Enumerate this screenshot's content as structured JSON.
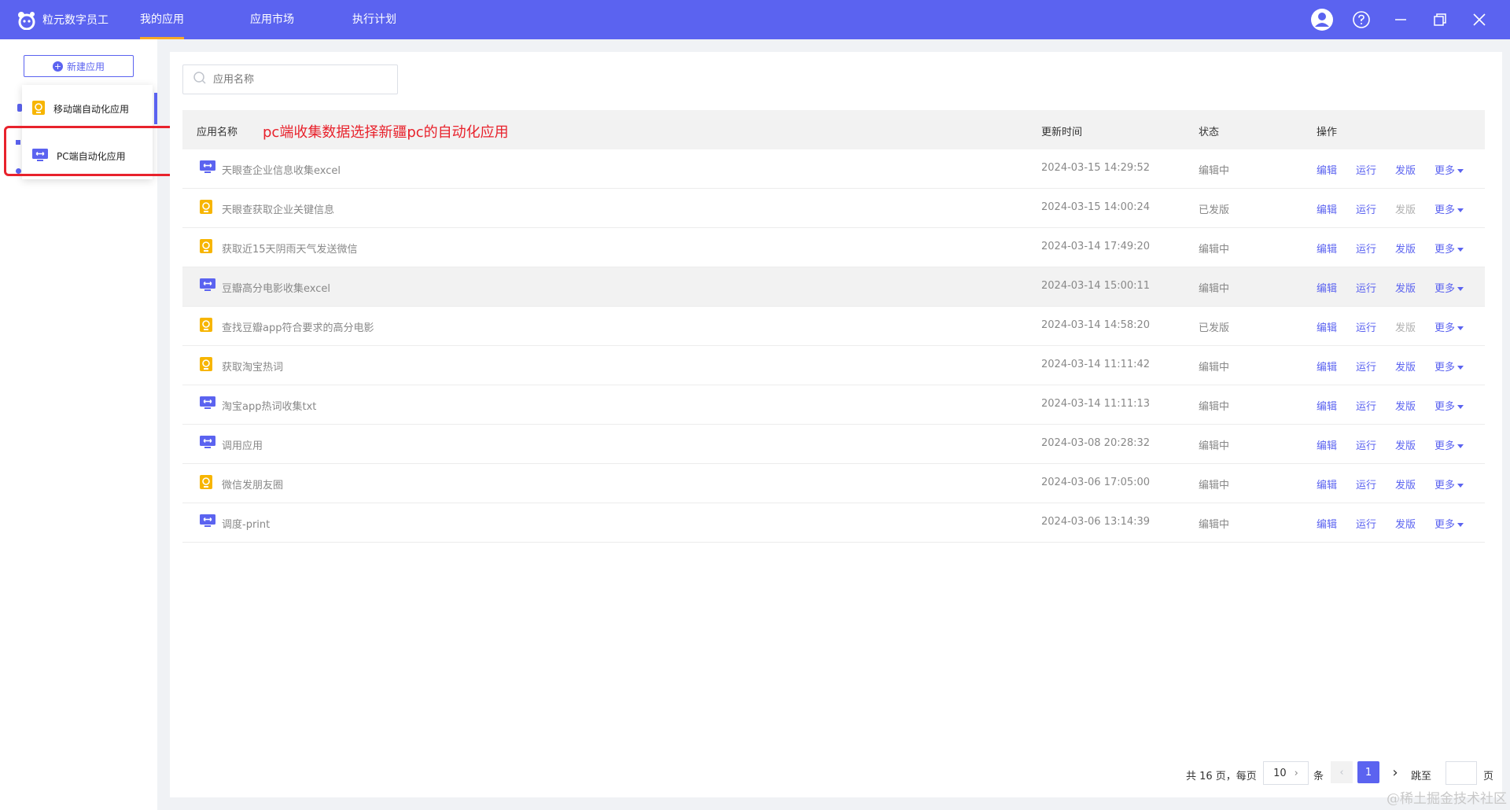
{
  "app": {
    "name": "粒元数字员工"
  },
  "nav": [
    {
      "label": "我的应用",
      "active": true
    },
    {
      "label": "应用市场",
      "active": false
    },
    {
      "label": "执行计划",
      "active": false
    }
  ],
  "window_controls": [
    "user-icon",
    "help-icon",
    "minimize-icon",
    "restore-icon",
    "close-icon"
  ],
  "sidebar": {
    "new_button": "新建应用"
  },
  "dropdown": {
    "items": [
      {
        "label": "移动端自动化应用",
        "icon": "mobile-app-icon"
      },
      {
        "label": "PC端自动化应用",
        "icon": "pc-app-icon"
      }
    ]
  },
  "search": {
    "placeholder": "应用名称"
  },
  "annotation": "pc端收集数据选择新疆pc的自动化应用",
  "table": {
    "headers": {
      "name": "应用名称",
      "updated": "更新时间",
      "status": "状态",
      "actions": "操作"
    },
    "action_labels": {
      "edit": "编辑",
      "run": "运行",
      "publish": "发版",
      "more": "更多"
    },
    "rows": [
      {
        "type": "pc",
        "name": "天眼查企业信息收集excel",
        "updated": "2024-03-15 14:29:52",
        "status": "编辑中",
        "publish_enabled": true
      },
      {
        "type": "mobile",
        "name": "天眼查获取企业关键信息",
        "updated": "2024-03-15 14:00:24",
        "status": "已发版",
        "publish_enabled": false
      },
      {
        "type": "mobile",
        "name": "获取近15天阴雨天气发送微信",
        "updated": "2024-03-14 17:49:20",
        "status": "编辑中",
        "publish_enabled": true
      },
      {
        "type": "pc",
        "name": "豆瓣高分电影收集excel",
        "updated": "2024-03-14 15:00:11",
        "status": "编辑中",
        "publish_enabled": true
      },
      {
        "type": "mobile",
        "name": "查找豆瓣app符合要求的高分电影",
        "updated": "2024-03-14 14:58:20",
        "status": "已发版",
        "publish_enabled": false
      },
      {
        "type": "mobile",
        "name": "获取淘宝热词",
        "updated": "2024-03-14 11:11:42",
        "status": "编辑中",
        "publish_enabled": true
      },
      {
        "type": "pc",
        "name": "淘宝app热词收集txt",
        "updated": "2024-03-14 11:11:13",
        "status": "编辑中",
        "publish_enabled": true
      },
      {
        "type": "pc",
        "name": "调用应用",
        "updated": "2024-03-08 20:28:32",
        "status": "编辑中",
        "publish_enabled": true
      },
      {
        "type": "mobile",
        "name": "微信发朋友圈",
        "updated": "2024-03-06 17:05:00",
        "status": "编辑中",
        "publish_enabled": true
      },
      {
        "type": "pc",
        "name": "调度-print",
        "updated": "2024-03-06 13:14:39",
        "status": "编辑中",
        "publish_enabled": true
      }
    ]
  },
  "pagination": {
    "total_prefix": "共 16 页，每页",
    "page_size": "10",
    "unit": "条",
    "current": "1",
    "jump_label": "跳至",
    "page_suffix": "页"
  },
  "watermark": "@稀土掘金技术社区",
  "colors": {
    "primary": "#5b63f0",
    "accent": "#f7a928",
    "annotation": "#e8222c"
  }
}
